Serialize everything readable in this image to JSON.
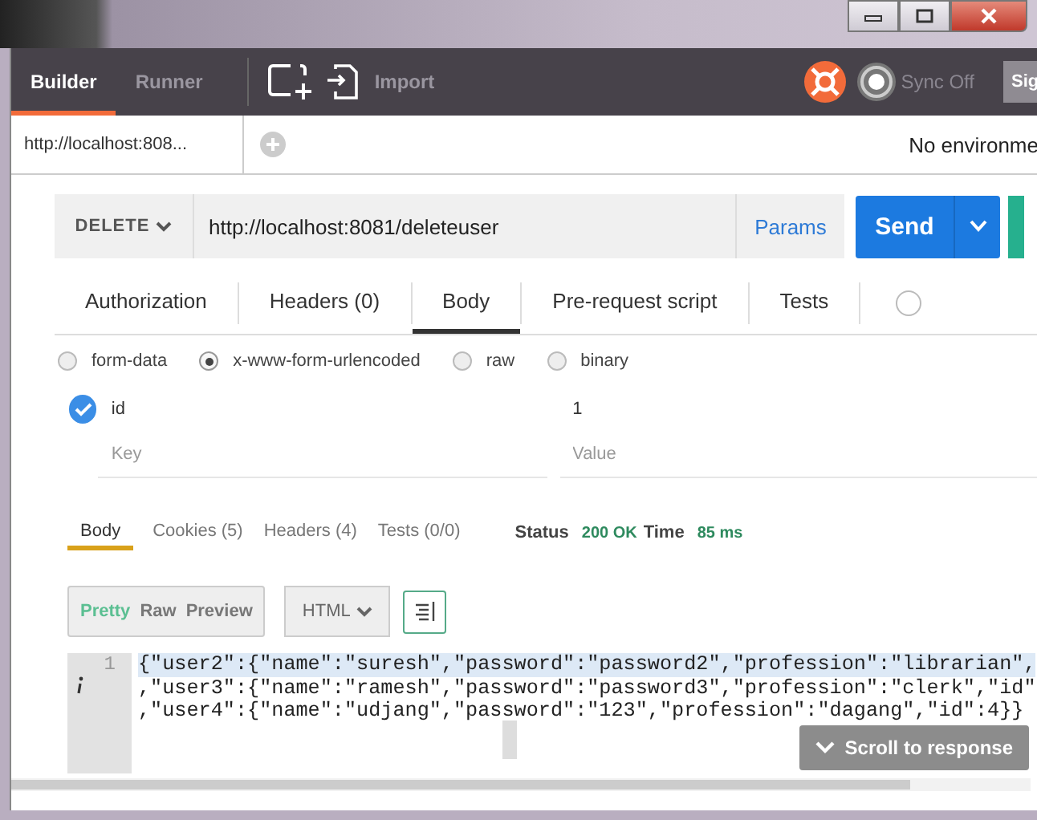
{
  "header": {
    "tabs": [
      {
        "label": "Builder",
        "selected": true
      },
      {
        "label": "Runner",
        "selected": false
      }
    ],
    "import_label": "Import",
    "sync_label": "Sync Off",
    "sign_label": "Sig"
  },
  "request_tabs": [
    {
      "label": "http://localhost:808...",
      "selected": true
    }
  ],
  "environment": "No environme",
  "request": {
    "method": "DELETE",
    "url": "http://localhost:8081/deleteuser",
    "params_label": "Params",
    "send_label": "Send"
  },
  "request_sections": [
    {
      "label": "Authorization",
      "selected": false
    },
    {
      "label": "Headers (0)",
      "selected": false
    },
    {
      "label": "Body",
      "selected": true
    },
    {
      "label": "Pre-request script",
      "selected": false
    },
    {
      "label": "Tests",
      "selected": false
    }
  ],
  "body_modes": [
    {
      "label": "form-data",
      "selected": false
    },
    {
      "label": "x-www-form-urlencoded",
      "selected": true
    },
    {
      "label": "raw",
      "selected": false
    },
    {
      "label": "binary",
      "selected": false
    }
  ],
  "params": [
    {
      "key": "id",
      "value": "1",
      "checked": true
    }
  ],
  "new_param": {
    "key_placeholder": "Key",
    "value_placeholder": "Value"
  },
  "response_tabs": [
    {
      "label": "Body",
      "selected": true
    },
    {
      "label": "Cookies (5)",
      "selected": false
    },
    {
      "label": "Headers (4)",
      "selected": false
    },
    {
      "label": "Tests (0/0)",
      "selected": false
    }
  ],
  "status": {
    "status_label": "Status",
    "status_value": "200 OK",
    "time_label": "Time",
    "time_value": "85 ms"
  },
  "view_modes": [
    {
      "label": "Pretty",
      "selected": true
    },
    {
      "label": "Raw",
      "selected": false
    },
    {
      "label": "Preview",
      "selected": false
    }
  ],
  "format": "HTML",
  "code": {
    "line_numbers": [
      "1"
    ],
    "lines": [
      "{\"user2\":{\"name\":\"suresh\",\"password\":\"password2\",\"profession\":\"librarian\",",
      ",\"user3\":{\"name\":\"ramesh\",\"password\":\"password3\",\"profession\":\"clerk\",\"id\"",
      ",\"user4\":{\"name\":\"udjang\",\"password\":\"123\",\"profession\":\"dagang\",\"id\":4}}"
    ]
  },
  "scroll_button": "Scroll to response"
}
